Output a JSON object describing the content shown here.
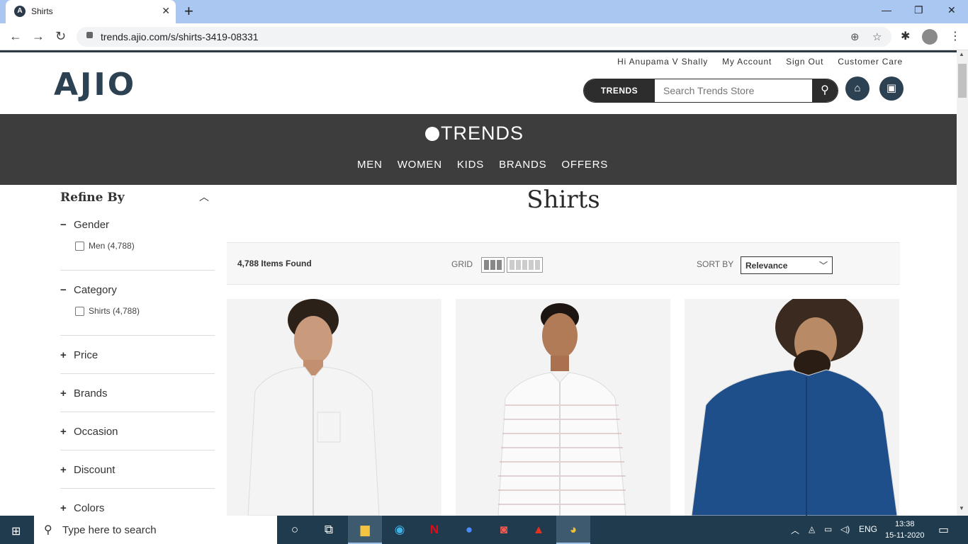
{
  "browser": {
    "tab_title": "Shirts",
    "tab_favicon": "A",
    "tab_close": "✕",
    "new_tab": "+",
    "url": "trends.ajio.com/s/shirts-3419-08331",
    "window_controls": {
      "minimize": "—",
      "maximize": "❐",
      "close": "✕"
    }
  },
  "header": {
    "logo": "AJIO",
    "greeting": "Hi Anupama V Shally",
    "my_account": "My Account",
    "sign_out": "Sign Out",
    "customer_care": "Customer Care",
    "search_store_label": "TRENDS",
    "search_placeholder": "Search Trends Store"
  },
  "store": {
    "name": "TRENDS",
    "menu": [
      "MEN",
      "WOMEN",
      "KIDS",
      "BRANDS",
      "OFFERS"
    ]
  },
  "sidebar": {
    "title": "Refine By",
    "facets": [
      {
        "name": "Gender",
        "expanded": true,
        "sign": "−",
        "options": [
          "Men (4,788)"
        ]
      },
      {
        "name": "Category",
        "expanded": true,
        "sign": "−",
        "options": [
          "Shirts (4,788)"
        ]
      },
      {
        "name": "Price",
        "expanded": false,
        "sign": "+"
      },
      {
        "name": "Brands",
        "expanded": false,
        "sign": "+"
      },
      {
        "name": "Occasion",
        "expanded": false,
        "sign": "+"
      },
      {
        "name": "Discount",
        "expanded": false,
        "sign": "+"
      },
      {
        "name": "Colors",
        "expanded": false,
        "sign": "+"
      }
    ]
  },
  "main": {
    "title": "Shirts",
    "items_found": "4,788 Items Found",
    "grid_label": "GRID",
    "sort_label": "SORT BY",
    "sort_value": "Relevance",
    "products": [
      {
        "shirt_color": "#f4f4f4"
      },
      {
        "shirt_color": "#fafafa"
      },
      {
        "shirt_color": "#1f4f8a"
      }
    ]
  },
  "taskbar": {
    "search_text": "Type here to search",
    "language": "ENG",
    "time": "13:38",
    "date": "15-11-2020"
  },
  "colors": {
    "brand": "#2c4152",
    "nav_band": "#3d3d3d",
    "taskbar": "#1f3b4d"
  }
}
